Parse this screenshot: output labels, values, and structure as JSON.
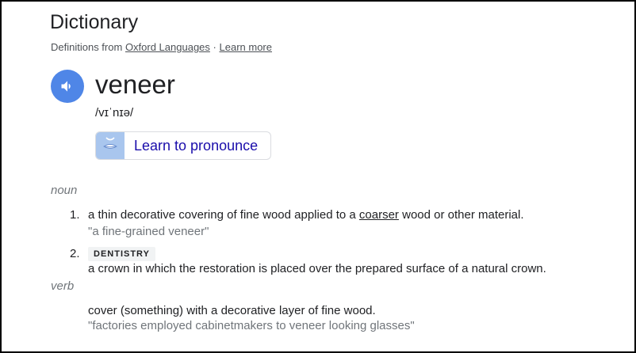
{
  "header": {
    "title": "Dictionary",
    "source_prefix": "Definitions from",
    "source_link": "Oxford Languages",
    "separator": "·",
    "learn_more": "Learn more"
  },
  "entry": {
    "word": "veneer",
    "phonetic": "/vɪˈnɪə/",
    "pronounce_label": "Learn to pronounce",
    "speaker_icon": "speaker-icon",
    "pronounce_icon": "lips-icon"
  },
  "noun": {
    "pos": "noun",
    "senses": [
      {
        "number": "1.",
        "text_before": "a thin decorative covering of fine wood applied to a",
        "link_term": "coarser",
        "text_after": "wood or other material.",
        "example": "\"a fine-grained veneer\""
      },
      {
        "number": "2.",
        "label": "DENTISTRY",
        "text": "a crown in which the restoration is placed over the prepared surface of a natural crown."
      }
    ]
  },
  "verb": {
    "pos": "verb",
    "text": "cover (something) with a decorative layer of fine wood.",
    "example": "\"factories employed cabinetmakers to veneer looking glasses\""
  },
  "colors": {
    "speaker_bg": "#4f86e7",
    "link_blue": "#1a0dab",
    "muted": "#70757a"
  }
}
